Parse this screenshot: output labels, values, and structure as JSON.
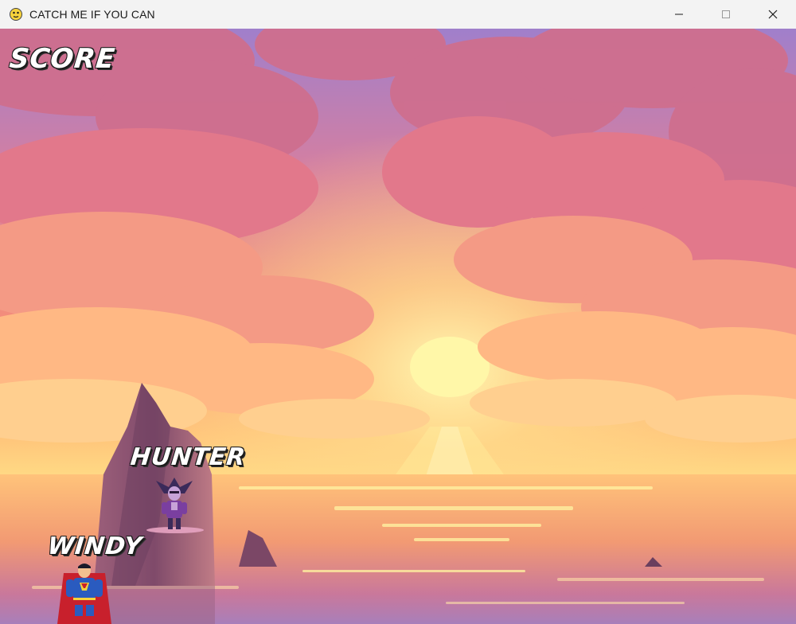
{
  "window": {
    "title": "CATCH ME IF YOU CAN",
    "app_icon": "pygame-snake-icon",
    "controls": {
      "minimize": "minimize-icon",
      "maximize": "maximize-icon",
      "close": "close-icon"
    }
  },
  "hud": {
    "score_label": "SCORE"
  },
  "characters": {
    "hunter": {
      "label": "HUNTER",
      "sprite": "villain-sprite"
    },
    "windy": {
      "label": "WINDY",
      "sprite": "superhero-sprite"
    }
  },
  "colors": {
    "sky_top": "#9f7ec8",
    "sky_mid": "#f07a7c",
    "horizon": "#ffd27a",
    "sun": "#fff6a6",
    "sea": "#f6a56a",
    "rock": "#7a4d6a",
    "label_text": "#ffffff",
    "label_outline": "#1a1a1a"
  }
}
